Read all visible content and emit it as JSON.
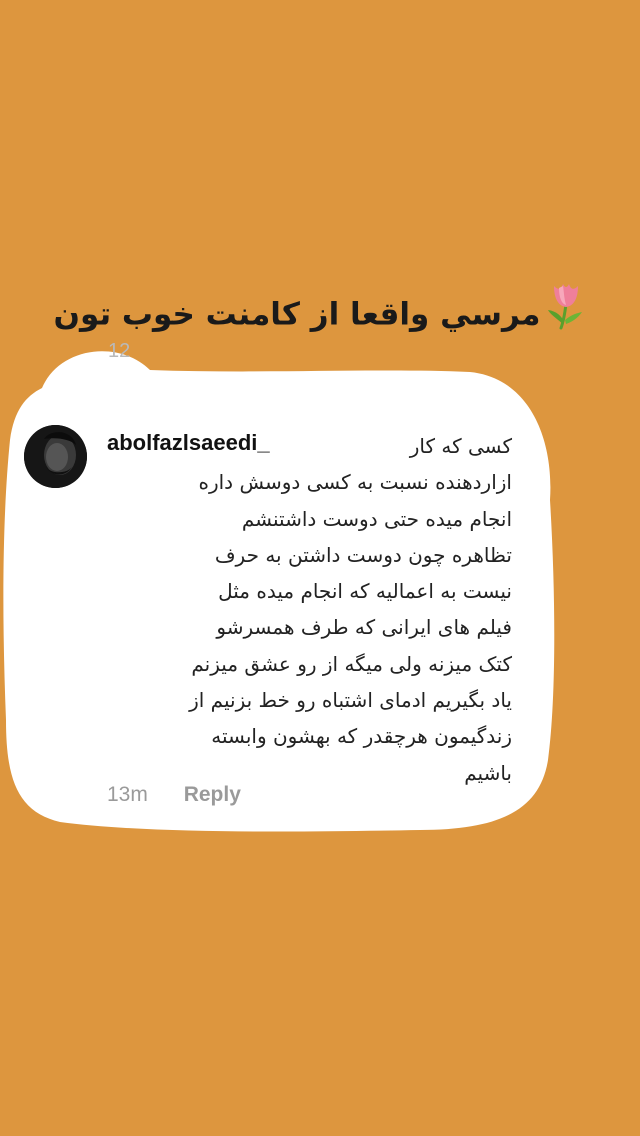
{
  "headline": {
    "text": "مرسي واقعا از كامنت خوب تون"
  },
  "background": {
    "peek_time": "12"
  },
  "comment": {
    "username": "abolfazlsaeedi_",
    "first_line": "کسی که کار",
    "lines": [
      "ازاردهنده نسبت به کسی دوسش داره",
      "انجام میده حتی دوست داشتنشم",
      "تظاهره چون دوست داشتن به حرف",
      "نیست به اعمالیه که انجام میده مثل",
      "فیلم های ایرانی که طرف همسرشو",
      "کتک میزنه ولی میگه از رو عشق میزنم",
      "یاد بگیریم ادمای اشتباه رو خط بزنیم از",
      "زندگیمون هرچقدر که بهشون وابسته",
      "باشیم"
    ],
    "time_ago": "13m",
    "reply_label": "Reply"
  },
  "colors": {
    "background": "#DD963E",
    "bubble": "#FFFFFF",
    "meta_text": "#9A9A9A"
  },
  "icons": {
    "headline_emoji": "tulip-icon"
  }
}
